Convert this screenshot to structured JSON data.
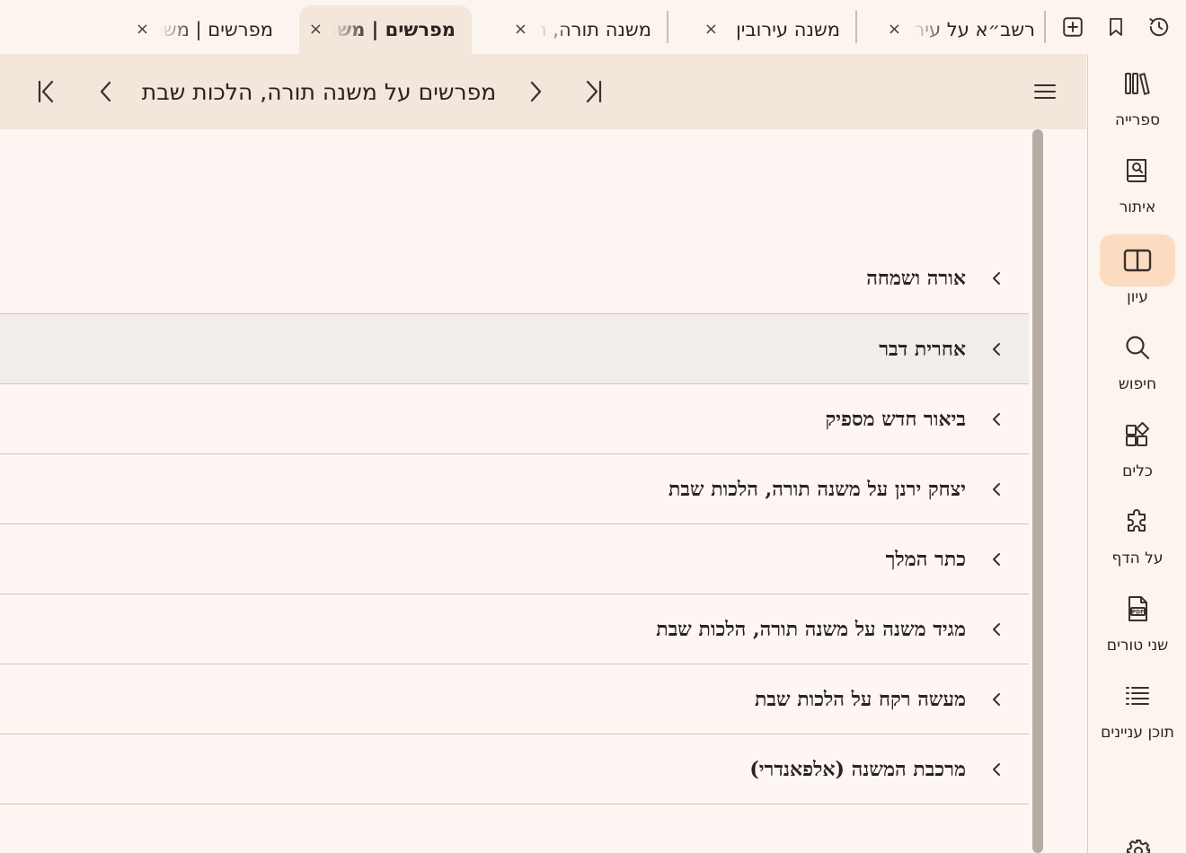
{
  "tabs": [
    {
      "label": "רשב״א על עירובין",
      "close": "×",
      "active": false
    },
    {
      "label": "משנה עירובין",
      "close": "×",
      "active": false
    },
    {
      "label": "משנה תורה, הלכות שבת",
      "close": "×",
      "active": false
    },
    {
      "label": "מפרשים | משנה תורה, הלכות שבת",
      "close": "×",
      "active": true
    },
    {
      "label": "מפרשים | משנה עירובין",
      "close": "×",
      "active": false
    }
  ],
  "top_icons": [
    "history-icon",
    "bookmark-icon",
    "new-tab-icon"
  ],
  "header": {
    "title": "מפרשים על משנה תורה, הלכות שבת",
    "menu_icon": "hamburger-menu-icon"
  },
  "rail": {
    "items": [
      {
        "label": "ספרייה",
        "icon": "library-icon",
        "selected": false
      },
      {
        "label": "איתור",
        "icon": "book-search-icon",
        "selected": false
      },
      {
        "label": "עיון",
        "icon": "open-book-icon",
        "selected": true
      },
      {
        "label": "חיפוש",
        "icon": "search-icon",
        "selected": false
      },
      {
        "label": "כלים",
        "icon": "tools-icon",
        "selected": false
      },
      {
        "label": "על הדף",
        "icon": "puzzle-icon",
        "selected": false
      },
      {
        "label": "שני טורים",
        "icon": "pdf-icon",
        "selected": false
      },
      {
        "label": "תוכן עניינים",
        "icon": "list-icon",
        "selected": false
      }
    ],
    "settings_icon": "gear-icon"
  },
  "commentaries": [
    "אורה ושמחה",
    "אחרית דבר",
    "ביאור חדש מספיק",
    "יצחק ירנן על משנה תורה, הלכות שבת",
    "כתר המלך",
    "מגיד משנה על משנה תורה, הלכות שבת",
    "מעשה רקח על הלכות שבת",
    "מרכבת המשנה (אלפאנדרי)"
  ],
  "colors": {
    "background": "#fdf6f2",
    "header": "#f3e6db",
    "selected_rail": "#fbdcc0",
    "text": "#2a2320"
  }
}
